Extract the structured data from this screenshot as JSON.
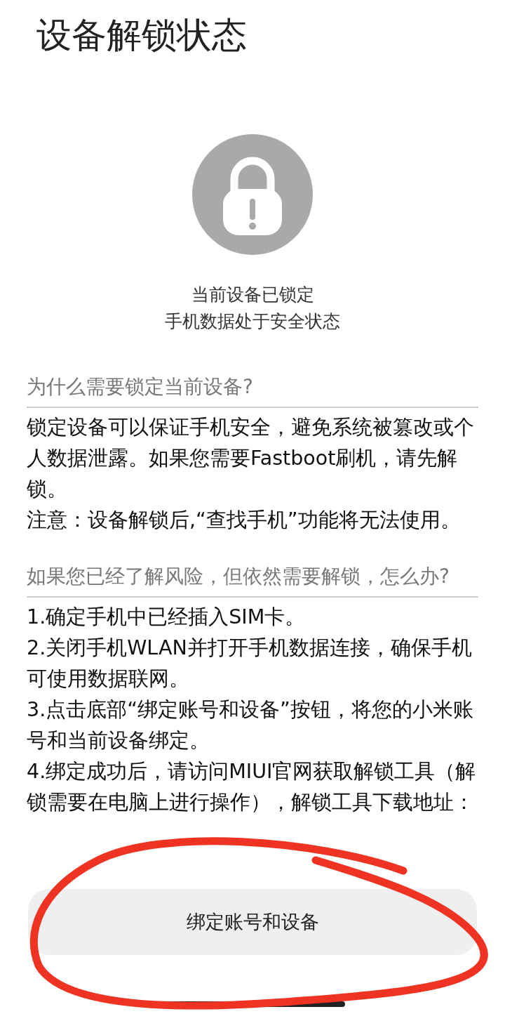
{
  "title": "设备解锁状态",
  "status": {
    "lines": [
      "当前设备已锁定",
      "手机数据处于安全状态"
    ]
  },
  "sections": [
    {
      "heading": "为什么需要锁定当前设备?",
      "paragraphs": [
        "锁定设备可以保证手机安全，避免系统被篡改或个人数据泄露。如果您需要Fastboot刷机，请先解锁。",
        "注意：设备解锁后,“查找手机”功能将无法使用。"
      ]
    },
    {
      "heading": "如果您已经了解风险，但依然需要解锁，怎么办?",
      "paragraphs": [
        "1.确定手机中已经插入SIM卡。",
        "2.关闭手机WLAN并打开手机数据连接，确保手机可使用数据联网。",
        "3.点击底部“绑定账号和设备”按钮，将您的小米账号和当前设备绑定。",
        "4.绑定成功后，请访问MIUI官网获取解锁工具（解锁需要在电脑上进行操作），解锁工具下载地址："
      ]
    }
  ],
  "button": {
    "label": "绑定账号和设备"
  }
}
